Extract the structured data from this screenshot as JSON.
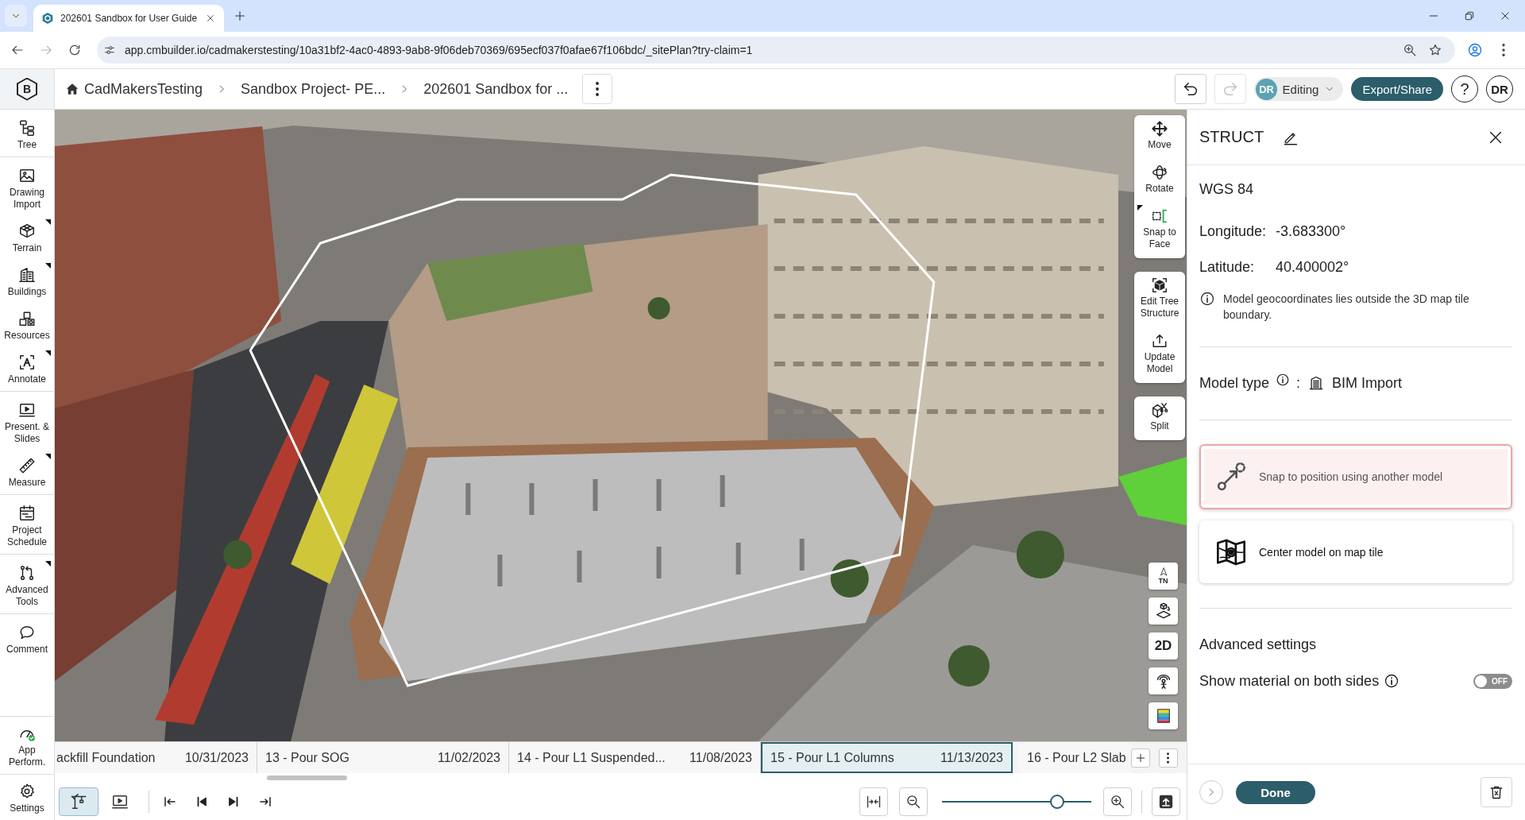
{
  "browser": {
    "tab": {
      "title": "202601 Sandbox for User Guide"
    },
    "nav": {
      "back_disabled": false,
      "forward_disabled": true
    },
    "url": "app.cmbuilder.io/cadmakerstesting/10a31bf2-4ac0-4893-9ab8-9f06deb70369/695ecf037f0afae67f106bdc/_sitePlan?try-claim=1"
  },
  "header": {
    "logo": "B",
    "breadcrumbs": [
      {
        "label": "CadMakersTesting",
        "kind": "home"
      },
      {
        "label": "Sandbox Project- PE...",
        "kind": "page"
      },
      {
        "label": "202601 Sandbox for ...",
        "kind": "page"
      }
    ],
    "undo": {
      "disabled": false
    },
    "redo": {
      "disabled": true
    },
    "mode": {
      "initials": "DR",
      "label": "Editing"
    },
    "export_button": "Export/Share",
    "help": "?",
    "user": "DR"
  },
  "sidebar": {
    "groups": [
      [
        {
          "label": "Tree",
          "kind": "tree",
          "submenu": false
        }
      ],
      [
        {
          "label": "Drawing Import",
          "kind": "drawing",
          "submenu": false
        },
        {
          "label": "Terrain",
          "kind": "terrain",
          "submenu": true
        },
        {
          "label": "Buildings",
          "kind": "buildings",
          "submenu": true
        },
        {
          "label": "Resources",
          "kind": "resources",
          "submenu": false
        },
        {
          "label": "Annotate",
          "kind": "annotate",
          "submenu": true
        }
      ],
      [
        {
          "label": "Present. & Slides",
          "kind": "present",
          "submenu": false
        },
        {
          "label": "Measure",
          "kind": "measure",
          "submenu": true
        }
      ],
      [
        {
          "label": "Project Schedule",
          "kind": "schedule",
          "submenu": false
        }
      ],
      [
        {
          "label": "Advanced Tools",
          "kind": "advanced",
          "submenu": true
        }
      ],
      [
        {
          "label": "Comment",
          "kind": "comment",
          "submenu": false
        }
      ]
    ],
    "bottom": [
      {
        "label": "App Perform.",
        "kind": "performance",
        "submenu": false
      },
      {
        "label": "Settings",
        "kind": "settings",
        "submenu": false
      }
    ]
  },
  "model_tools": [
    [
      {
        "label": "Move",
        "kind": "move",
        "submenu": false
      },
      {
        "label": "Rotate",
        "kind": "rotate",
        "submenu": false
      },
      {
        "label": "Snap to Face",
        "kind": "snap_face",
        "submenu": true
      }
    ],
    [
      {
        "label": "Edit Tree Structure",
        "kind": "edit_tree",
        "submenu": false
      },
      {
        "label": "Update Model",
        "kind": "update",
        "submenu": false
      }
    ],
    [
      {
        "label": "Split",
        "kind": "split",
        "submenu": false
      }
    ]
  ],
  "view_controls": [
    {
      "kind": "north",
      "label": "TN"
    },
    {
      "kind": "orbit"
    },
    {
      "kind": "mode",
      "label": "2D"
    },
    {
      "kind": "person"
    },
    {
      "kind": "layers"
    }
  ],
  "timeline": {
    "items": [
      {
        "name": "ackfill Foundation",
        "date": "10/31/2023",
        "selected": false
      },
      {
        "name": "13 - Pour SOG",
        "date": "11/02/2023",
        "selected": false
      },
      {
        "name": "14 - Pour L1 Suspended...",
        "date": "11/08/2023",
        "selected": false
      },
      {
        "name": "15 - Pour L1 Columns",
        "date": "11/13/2023",
        "selected": true
      },
      {
        "name": "16 - Pour L2 Slab",
        "selected": false
      }
    ]
  },
  "player": {
    "views": [
      {
        "kind": "site",
        "selected": true
      },
      {
        "kind": "presentation",
        "selected": false
      }
    ],
    "zoom": {
      "level": 0.8
    }
  },
  "panel": {
    "title": "STRUCT",
    "coordinate_system": "WGS 84",
    "coordinates": [
      {
        "label": "Longitude:",
        "value": "-3.683300°"
      },
      {
        "label": "Latitude:",
        "value": "40.400002°"
      }
    ],
    "notice": "Model geocoordinates lies outside the 3D map tile boundary.",
    "model_type": {
      "label": "Model type",
      "separator": ":",
      "value": "BIM Import"
    },
    "actions": [
      {
        "label": "Snap to position using another model",
        "kind": "snap",
        "selected": true
      },
      {
        "label": "Center model on map tile",
        "kind": "center",
        "selected": false
      }
    ],
    "advanced": {
      "title": "Advanced settings",
      "settings": [
        {
          "label": "Show material on both sides",
          "on": false,
          "state_label": "OFF"
        }
      ]
    },
    "done_button": "Done"
  }
}
